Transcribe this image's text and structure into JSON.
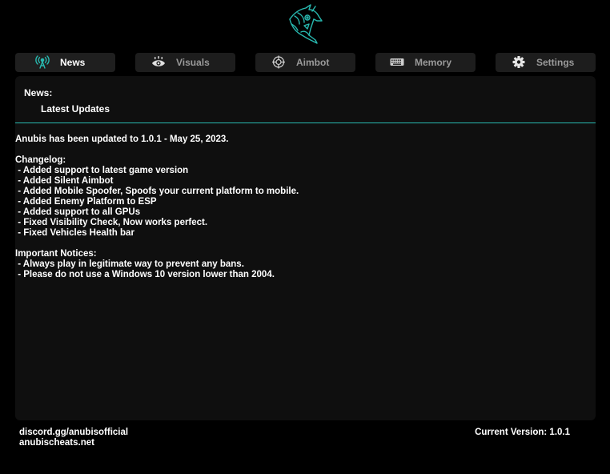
{
  "colors": {
    "accent": "#28b9b0",
    "background": "#000000",
    "panel": "#0f0f0f",
    "tab": "#1d1d1d",
    "tab_inactive_text": "#9a9a9a"
  },
  "logo": {
    "icon": "anubis-jackal-logo"
  },
  "tabs": [
    {
      "label": "News",
      "icon": "antenna-icon",
      "active": true
    },
    {
      "label": "Visuals",
      "icon": "eye-icon",
      "active": false
    },
    {
      "label": "Aimbot",
      "icon": "crosshair-icon",
      "active": false
    },
    {
      "label": "Memory",
      "icon": "keyboard-icon",
      "active": false
    },
    {
      "label": "Settings",
      "icon": "gear-icon",
      "active": false
    }
  ],
  "news": {
    "title": "News:",
    "subtitle": "Latest Updates",
    "update_line": "Anubis has been updated to 1.0.1 - May 25, 2023.",
    "changelog_title": "Changelog:",
    "changelog": [
      " - Added support to latest game version",
      " - Added Silent Aimbot",
      " - Added Mobile Spoofer, Spoofs your current platform to mobile.",
      " - Added Enemy Platform to ESP",
      " - Added support to all GPUs",
      " - Fixed Visibility Check, Now works perfect.",
      " - Fixed Vehicles Health bar"
    ],
    "notices_title": "Important Notices:",
    "notices": [
      " - Always play in legitimate way to prevent any bans.",
      " - Please do not use a Windows 10 version lower than 2004."
    ]
  },
  "footer": {
    "discord": "discord.gg/anubisofficial",
    "website": "anubischeats.net",
    "version": "Current Version: 1.0.1"
  }
}
